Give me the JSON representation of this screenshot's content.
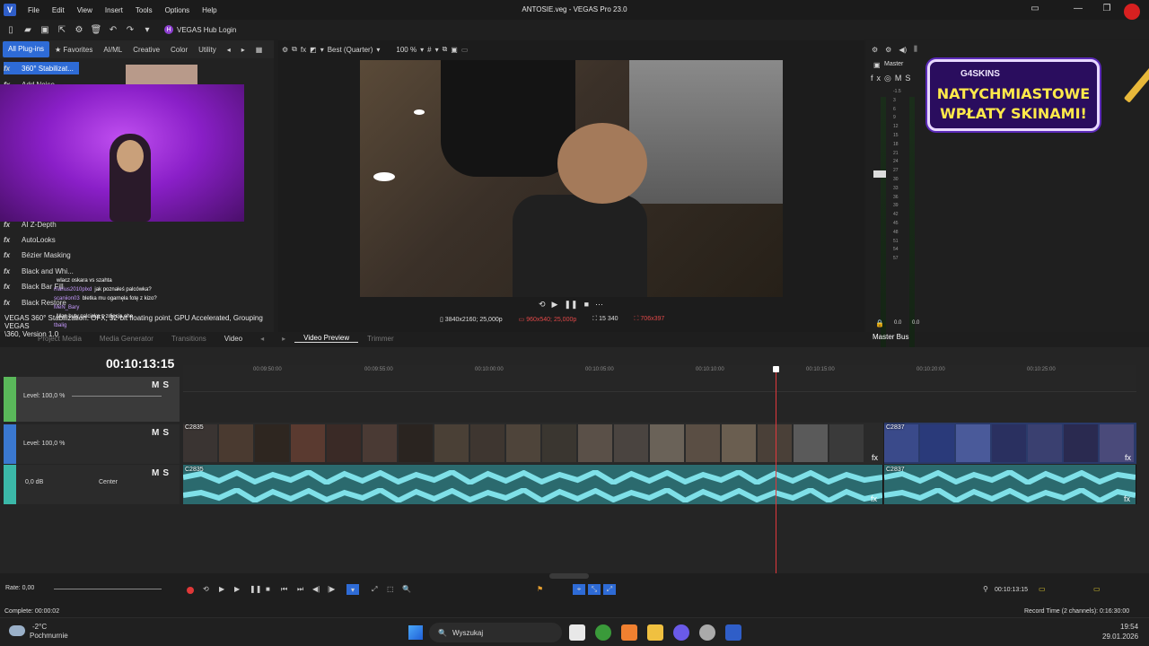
{
  "window": {
    "title": "ANTOSIE.veg - VEGAS Pro 23.0",
    "menu": [
      "File",
      "Edit",
      "View",
      "Insert",
      "Tools",
      "Options",
      "Help"
    ]
  },
  "toolbar": {
    "hub_login": "VEGAS Hub Login"
  },
  "plugins": {
    "tabs": [
      "All Plug-ins",
      "Favorites",
      "AI/ML",
      "Creative",
      "Color",
      "Utility"
    ],
    "items": [
      "360° Stabilizat...",
      "Add Noise",
      "AI Z-Depth",
      "AutoLooks",
      "Bézier Masking",
      "Black and Whi...",
      "Black Bar Fill",
      "Black Restore"
    ],
    "status_line1": "VEGAS 360° Stabilization: OFX, 32-bit floating point, GPU Accelerated, Grouping VEGAS",
    "status_line2": "\\360, Version 1.0"
  },
  "chat": [
    {
      "name": "",
      "text": "wlacz oskara vs szahta"
    },
    {
      "name": "marius2010plxd",
      "text": "jak poznałeś palcówka?"
    },
    {
      "name": "scaniion03",
      "text": "bletka mu ogarnęła fotę z kizo?"
    },
    {
      "name": "MeN_Bary",
      "text": ""
    },
    {
      "name": "",
      "text": "Man buty palciaka z zdjęcia ehe"
    },
    {
      "name": "tbalig",
      "text": ""
    }
  ],
  "preview": {
    "quality": "Best (Quarter)",
    "zoom": "100 %",
    "project_info": "3840x2160; 25,000p",
    "preview_res": "960x540; 25,000p",
    "frame": "15 340",
    "display": "706x397"
  },
  "master": {
    "label": "Master",
    "scale": [
      "-1.5",
      "-1.5",
      "3",
      "6",
      "9",
      "12",
      "15",
      "18",
      "21",
      "24",
      "27",
      "30",
      "33",
      "36",
      "39",
      "42",
      "45",
      "48",
      "51",
      "54",
      "57"
    ],
    "bottom_left": "0.0",
    "bottom_right": "0.0",
    "bus_tab": "Master Bus"
  },
  "ad": {
    "brand": "G4SKINS",
    "line1": "NATYCHMIASTOWE",
    "line2": "WPŁATY SKINAMI!"
  },
  "panel_tabs": [
    "Project Media",
    "Media Generator",
    "Transitions",
    "Video",
    "Video Preview",
    "Trimmer"
  ],
  "timeline": {
    "time": "00:10:13:15",
    "ruler": [
      "00:09:50:00",
      "00:09:55:00",
      "00:10:00:00",
      "00:10:05:00",
      "00:10:10:00",
      "00:10:15:00",
      "00:10:20:00",
      "00:10:25:00"
    ],
    "track1_level": "Level: 100,0 %",
    "track2_level": "Level: 100,0 %",
    "track3_volume": "0,0 dB",
    "track3_pan": "Center",
    "clip1": "C2835",
    "clip2": "C2837",
    "rate": "Rate: 0,00",
    "end_time": "00:10:13:15"
  },
  "status": {
    "left": "Complete: 00:00:02",
    "right": "Record Time (2 channels): 0:16:30:00"
  },
  "taskbar": {
    "weather_temp": "-2°C",
    "weather_desc": "Pochmurnie",
    "search": "Wyszukaj",
    "time": "19:54",
    "date": "29.01.2026"
  }
}
